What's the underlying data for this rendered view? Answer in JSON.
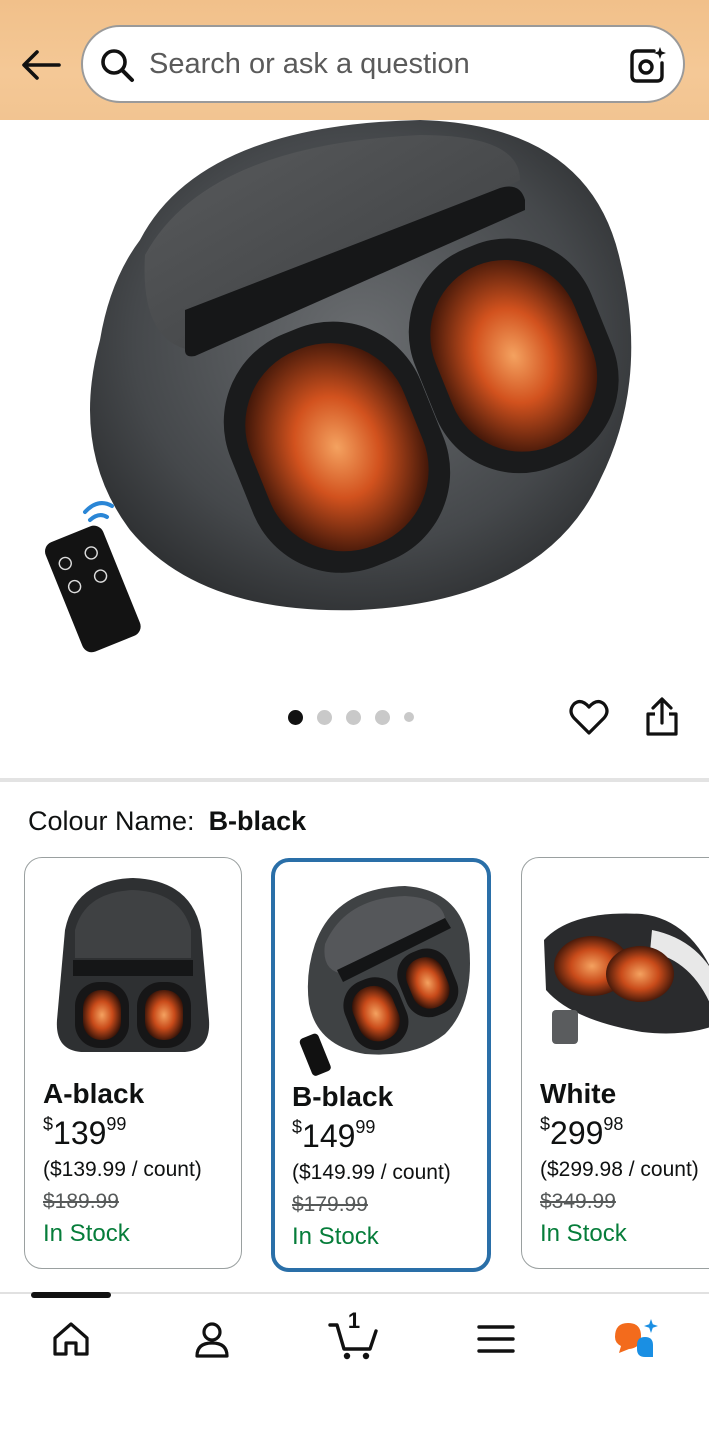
{
  "header": {
    "search_placeholder": "Search or ask a question",
    "back_icon": "arrow-left-icon",
    "search_icon": "search-icon",
    "lens_icon": "camera-lens-icon"
  },
  "gallery": {
    "image_count": 5,
    "active_index": 0,
    "heart_icon": "heart-icon",
    "share_icon": "share-icon"
  },
  "colour": {
    "label": "Colour Name:",
    "value": "B-black"
  },
  "variants": [
    {
      "name": "A-black",
      "price_symbol": "$",
      "price_whole": "139",
      "price_fraction": "99",
      "unit_price": "($139.99 / count)",
      "was_price": "$189.99",
      "stock": "In Stock",
      "selected": false
    },
    {
      "name": "B-black",
      "price_symbol": "$",
      "price_whole": "149",
      "price_fraction": "99",
      "unit_price": "($149.99 / count)",
      "was_price": "$179.99",
      "stock": "In Stock",
      "selected": true
    },
    {
      "name": "White",
      "price_symbol": "$",
      "price_whole": "299",
      "price_fraction": "98",
      "unit_price": "($299.98 / count)",
      "was_price": "$349.99",
      "stock": "In Stock",
      "selected": false
    }
  ],
  "bottom_nav": {
    "items": [
      {
        "icon": "home-icon",
        "active": true
      },
      {
        "icon": "account-icon",
        "active": false
      },
      {
        "icon": "cart-icon",
        "active": false
      },
      {
        "icon": "menu-icon",
        "active": false
      },
      {
        "icon": "rufus-assistant-icon",
        "active": false
      }
    ],
    "cart_count": "1"
  },
  "colors": {
    "header_bg": "#f2c491",
    "selected_border": "#2a6fa8",
    "in_stock": "#067d3a",
    "assistant_orange": "#f36b1c",
    "assistant_blue": "#1a8fe3"
  }
}
